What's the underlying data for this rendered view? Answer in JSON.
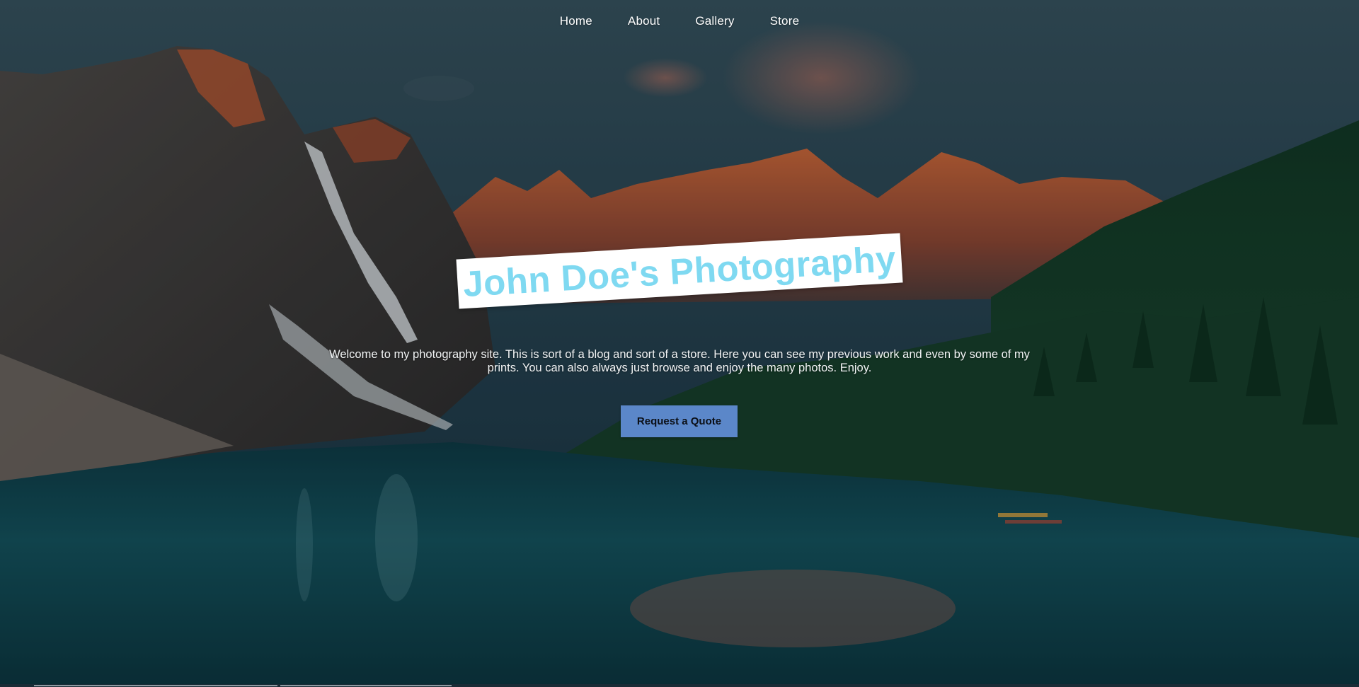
{
  "nav": {
    "items": [
      {
        "label": "Home"
      },
      {
        "label": "About"
      },
      {
        "label": "Gallery"
      },
      {
        "label": "Store"
      }
    ]
  },
  "hero": {
    "title": "John Doe's Photography",
    "intro": "Welcome to my photography site. This is sort of a blog and sort of a store. Here you can see my previous work and even by some of my prints. You can also always just browse and enjoy the many photos. Enjoy.",
    "cta_label": "Request a Quote",
    "background_image": "mountain-lake-photo"
  },
  "colors": {
    "title_text": "#7fd9f1",
    "title_box": "#ffffff",
    "cta_background": "#5b87c9",
    "nav_text": "#ffffff"
  }
}
